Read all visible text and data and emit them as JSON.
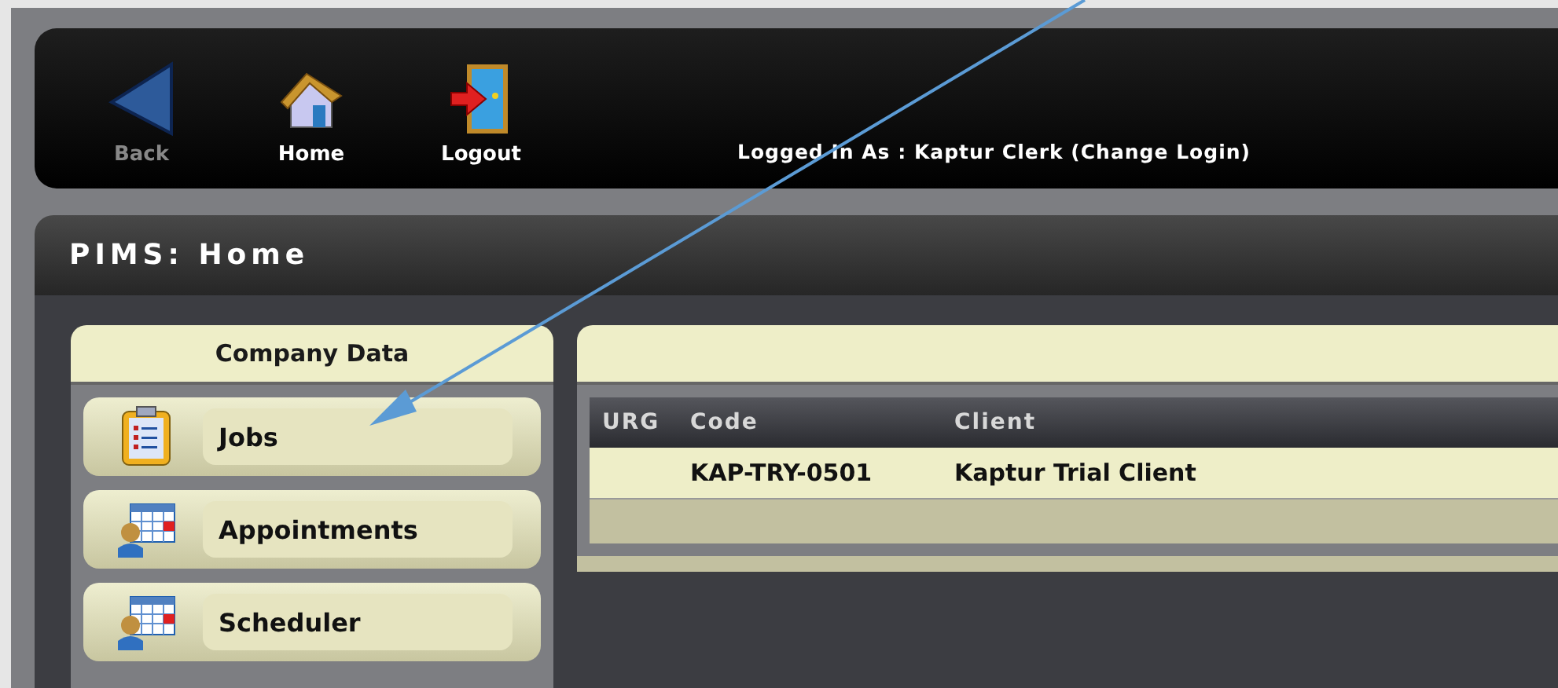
{
  "toolbar": {
    "buttons": [
      {
        "label": "Back",
        "kind": "back",
        "disabled": true
      },
      {
        "label": "Home",
        "kind": "home",
        "disabled": false
      },
      {
        "label": "Logout",
        "kind": "logout",
        "disabled": false
      }
    ],
    "login_text": "Logged In As : Kaptur Clerk (Change Login)"
  },
  "page_title": "PIMS: Home",
  "sidebar": {
    "title": "Company Data",
    "items": [
      {
        "label": "Jobs",
        "kind": "clipboard"
      },
      {
        "label": "Appointments",
        "kind": "calendar"
      },
      {
        "label": "Scheduler",
        "kind": "calendar"
      }
    ]
  },
  "table": {
    "columns": [
      "URG",
      "Code",
      "Client"
    ],
    "rows": [
      [
        "",
        "KAP-TRY-0501",
        "Kaptur Trial Client"
      ]
    ]
  }
}
